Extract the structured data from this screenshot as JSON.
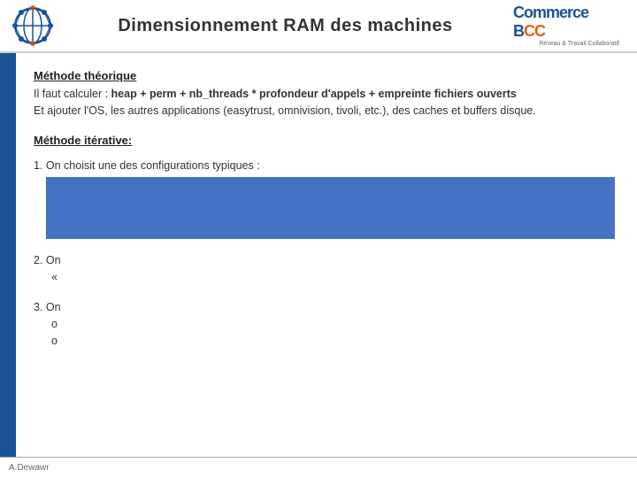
{
  "header": {
    "title": "Dimensionnement RAM des machines",
    "logo_alt": "network-globe-icon",
    "brand_name": "Commerce B",
    "brand_accent": "CC",
    "brand_tagline_line1": "Réseau & Travail Collaboratif"
  },
  "content": {
    "theoretical_section": {
      "title": "Méthode théorique",
      "line1_prefix": "Il faut calculer :  ",
      "line1_bold": "heap + perm + nb_threads * profondeur d'appels + empreinte fichiers ouverts",
      "line2": "Et ajouter l'OS, les autres applications (easytrust, omnivision, tivoli, etc.), des caches et buffers disque."
    },
    "iterative_section": {
      "title": "Méthode itérative:",
      "step1_label": "1. On choisit une des configurations typiques :",
      "step1_box_content": "",
      "step2_label": "2. On",
      "step2_indent": "«",
      "step3_label": "3. On",
      "step3_indent1": "o",
      "step3_indent2": "o"
    }
  },
  "footer": {
    "author": "A.Dewawr"
  }
}
